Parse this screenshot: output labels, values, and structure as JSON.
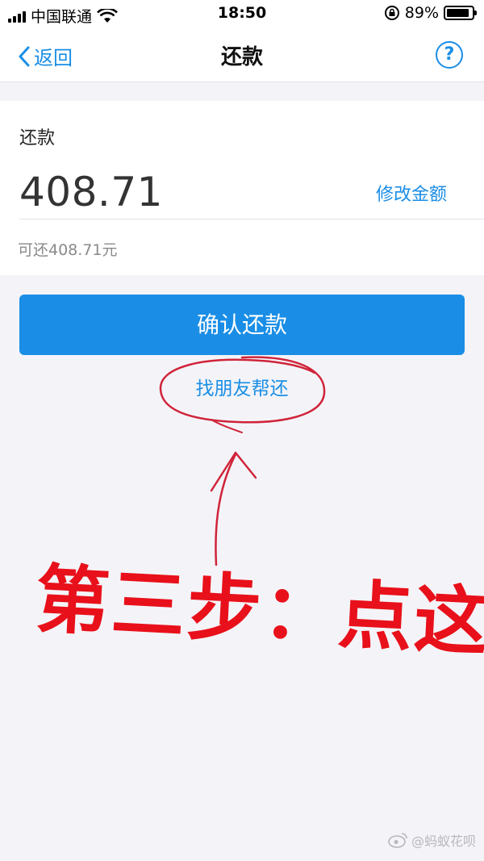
{
  "status_bar": {
    "carrier": "中国联通",
    "time": "18:50",
    "battery": "89%",
    "battery_level": 0.89
  },
  "nav": {
    "back_label": "返回",
    "title": "还款",
    "help_icon": "?"
  },
  "repayment": {
    "label": "还款",
    "amount": "408.71",
    "modify_label": "修改金额",
    "available_text": "可还408.71元"
  },
  "actions": {
    "confirm_label": "确认还款",
    "friend_label": "找朋友帮还"
  },
  "annotation": {
    "text": "第三步：点这里",
    "color": "#e8101a"
  },
  "watermark": {
    "text": "@蚂蚁花呗"
  },
  "colors": {
    "accent": "#1a8ee6",
    "background": "#f4f4f8"
  },
  "icons": [
    "signal-icon",
    "wifi-icon",
    "orientation-lock-icon",
    "battery-icon",
    "back-chevron-icon",
    "help-icon"
  ]
}
